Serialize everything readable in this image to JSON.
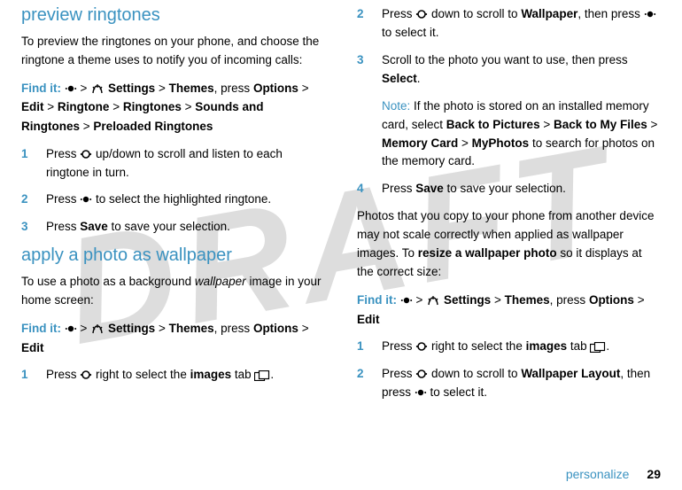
{
  "watermark": "DRAFT",
  "left": {
    "h1": "preview ringtones",
    "p1": "To preview the ringtones on your phone, and choose the ringtone a theme uses to notify you of incoming calls:",
    "findit_label": "Find it:",
    "findit_parts": {
      "gt1": ">",
      "settings": "Settings",
      "gt2": ">",
      "themes": "Themes",
      "press": ", press",
      "options": "Options",
      "gt3": ">",
      "edit": "Edit",
      "gt4": ">",
      "ringtone": "Ringtone",
      "gt5": ">",
      "ringtones": "Ringtones",
      "gt6": ">",
      "sar": "Sounds and Ringtones",
      "gt7": ">",
      "preloaded": "Preloaded Ringtones"
    },
    "s1_num": "1",
    "s1_a": "Press ",
    "s1_b": " up/down to scroll and listen to each ringtone in turn.",
    "s2_num": "2",
    "s2_a": "Press ",
    "s2_b": " to select the highlighted ringtone.",
    "s3_num": "3",
    "s3_a": "Press ",
    "s3_save": "Save",
    "s3_b": " to save your selection.",
    "h2": "apply a photo as wallpaper",
    "p2_a": "To use a photo as a background ",
    "p2_wall": "wallpaper",
    "p2_b": " image in your home screen:",
    "findit2_parts": {
      "gt1": ">",
      "settings": "Settings",
      "gt2": ">",
      "themes": "Themes",
      "press": ", press",
      "options": "Options",
      "gt3": ">",
      "edit": "Edit"
    },
    "sA_num": "1",
    "sA_a": "Press ",
    "sA_b": " right to select the ",
    "sA_images": "images",
    "sA_c": " tab ",
    "sA_d": "."
  },
  "right": {
    "s2_num": "2",
    "s2_a": "Press ",
    "s2_b": " down to scroll to ",
    "s2_wall": "Wallpaper",
    "s2_c": ", then press ",
    "s2_d": " to select it.",
    "s3_num": "3",
    "s3_a": "Scroll to the photo you want to use, then press ",
    "s3_sel": "Select",
    "s3_b": ".",
    "note_label": "Note:",
    "note_a": " If the photo is stored on an installed memory card, select ",
    "note_btp": "Back to Pictures",
    "note_gt1": " > ",
    "note_btmf": "Back to My Files",
    "note_gt2": " > ",
    "note_mem": "Memory Card",
    "note_gt3": " > ",
    "note_myp": "MyPhotos",
    "note_b": " to search for photos on the memory card.",
    "s4_num": "4",
    "s4_a": "Press ",
    "s4_save": "Save",
    "s4_b": " to save your selection.",
    "p_resize_a": "Photos that you copy to your phone from another device may not scale correctly when applied as wallpaper images. To ",
    "p_resize_bold": "resize a wallpaper photo",
    "p_resize_b": " so it displays at the correct size:",
    "findit3_parts": {
      "gt1": ">",
      "settings": "Settings",
      "gt2": ">",
      "themes": "Themes",
      "press": ", press",
      "options": "Options",
      "gt3": ">",
      "edit": "Edit"
    },
    "r1_num": "1",
    "r1_a": "Press ",
    "r1_b": " right to select the ",
    "r1_images": "images",
    "r1_c": " tab ",
    "r1_d": ".",
    "r2_num": "2",
    "r2_a": "Press ",
    "r2_b": " down to scroll to ",
    "r2_wl": "Wallpaper Layout",
    "r2_c": ", then press ",
    "r2_d": " to select it."
  },
  "footer": {
    "label": "personalize",
    "page": "29"
  }
}
